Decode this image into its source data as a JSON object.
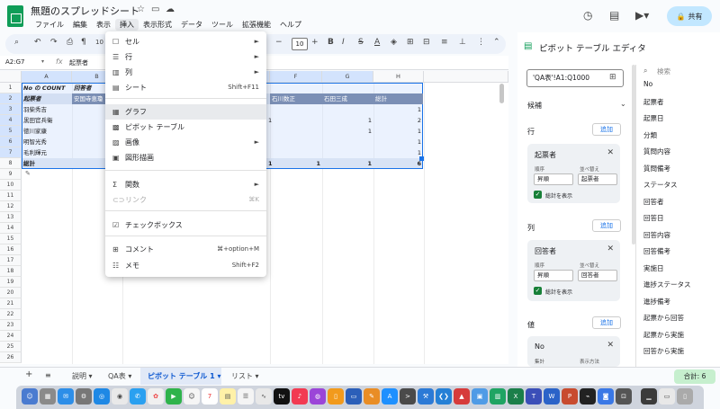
{
  "titlebar": {
    "doc_title": "無題のスプレッドシート",
    "menus": [
      "ファイル",
      "編集",
      "表示",
      "挿入",
      "表示形式",
      "データ",
      "ツール",
      "拡張機能",
      "ヘルプ"
    ],
    "share_label": "共有"
  },
  "toolbar": {
    "zoom_partial": "10",
    "font_size": "10"
  },
  "formula_bar": {
    "name_box": "A2:G7",
    "fx": "fx",
    "value": "起票者"
  },
  "grid": {
    "columns": [
      "A",
      "B",
      "F",
      "G",
      "H"
    ],
    "rows": [
      "1",
      "2",
      "3",
      "4",
      "5",
      "6",
      "7",
      "8",
      "9",
      "10",
      "11",
      "12",
      "13",
      "14",
      "15",
      "16",
      "17",
      "18",
      "19",
      "20",
      "21",
      "22",
      "23",
      "24",
      "25",
      "26"
    ],
    "r1": {
      "a": "No の COUNT",
      "b": "回答者"
    },
    "r2": {
      "a": "起票者",
      "b": "安国寺恵瓊",
      "f": "石川数正",
      "g": "石田三成",
      "h": "総計"
    },
    "names": [
      "羽柴秀吉",
      "黒田官兵衛",
      "徳川家康",
      "明智光秀",
      "毛利輝元"
    ],
    "f_vals": [
      "",
      "1",
      "",
      "",
      ""
    ],
    "g_vals": [
      "",
      "",
      "1",
      "",
      ""
    ],
    "g_vals2": [
      "1",
      "",
      "",
      "",
      ""
    ],
    "h_vals": [
      "1",
      "2",
      "1",
      "1",
      "1"
    ],
    "total_label": "総計",
    "total_e": "1",
    "total_f": "1",
    "total_g": "1",
    "total_h": "6"
  },
  "insert_menu": {
    "items": [
      {
        "icon": "☐",
        "label": "セル",
        "right": "►"
      },
      {
        "icon": "☰",
        "label": "行",
        "right": "►"
      },
      {
        "icon": "▥",
        "label": "列",
        "right": "►"
      },
      {
        "icon": "▤",
        "label": "シート",
        "right": "Shift+F11"
      },
      {
        "icon": "▦",
        "label": "グラフ",
        "right": ""
      },
      {
        "icon": "▩",
        "label": "ピボット テーブル",
        "right": ""
      },
      {
        "icon": "▨",
        "label": "画像",
        "right": "►"
      },
      {
        "icon": "▣",
        "label": "図形描画",
        "right": ""
      },
      {
        "icon": "Σ",
        "label": "関数",
        "right": "►"
      },
      {
        "icon": "⊂⊃",
        "label": "リンク",
        "right": "⌘K"
      },
      {
        "icon": "☑",
        "label": "チェックボックス",
        "right": ""
      },
      {
        "icon": "⊞",
        "label": "コメント",
        "right": "⌘+option+M"
      },
      {
        "icon": "☷",
        "label": "メモ",
        "right": "Shift+F2"
      }
    ]
  },
  "pivot_editor": {
    "title": "ピボット テーブル エディタ",
    "range": "'QA表'!A1:Q1000",
    "suggest": "候補",
    "rows_label": "行",
    "cols_label": "列",
    "values_label": "値",
    "add_label": "追加",
    "row_card": {
      "title": "起票者",
      "order_label": "順序",
      "sort_label": "並べ替え",
      "order": "昇順",
      "sort": "起票者",
      "show_total": "総計を表示"
    },
    "col_card": {
      "title": "回答者",
      "order_label": "順序",
      "sort_label": "並べ替え",
      "order": "昇順",
      "sort": "回答者",
      "show_total": "総計を表示"
    },
    "val_card": {
      "title": "No",
      "agg_label": "集計",
      "method_label": "表示方法"
    },
    "search_placeholder": "検索",
    "fields": [
      "No",
      "起票者",
      "起票日",
      "分類",
      "質問内容",
      "質問備考",
      "ステータス",
      "回答者",
      "回答日",
      "回答内容",
      "回答備考",
      "実施日",
      "進捗ステータス",
      "進捗備考",
      "起票から回答",
      "起票から実施",
      "回答から実施"
    ]
  },
  "sheet_tabs": {
    "tabs": [
      "説明",
      "QA表",
      "ピボット テーブル 1",
      "リスト"
    ],
    "sum": "合計: 6"
  }
}
